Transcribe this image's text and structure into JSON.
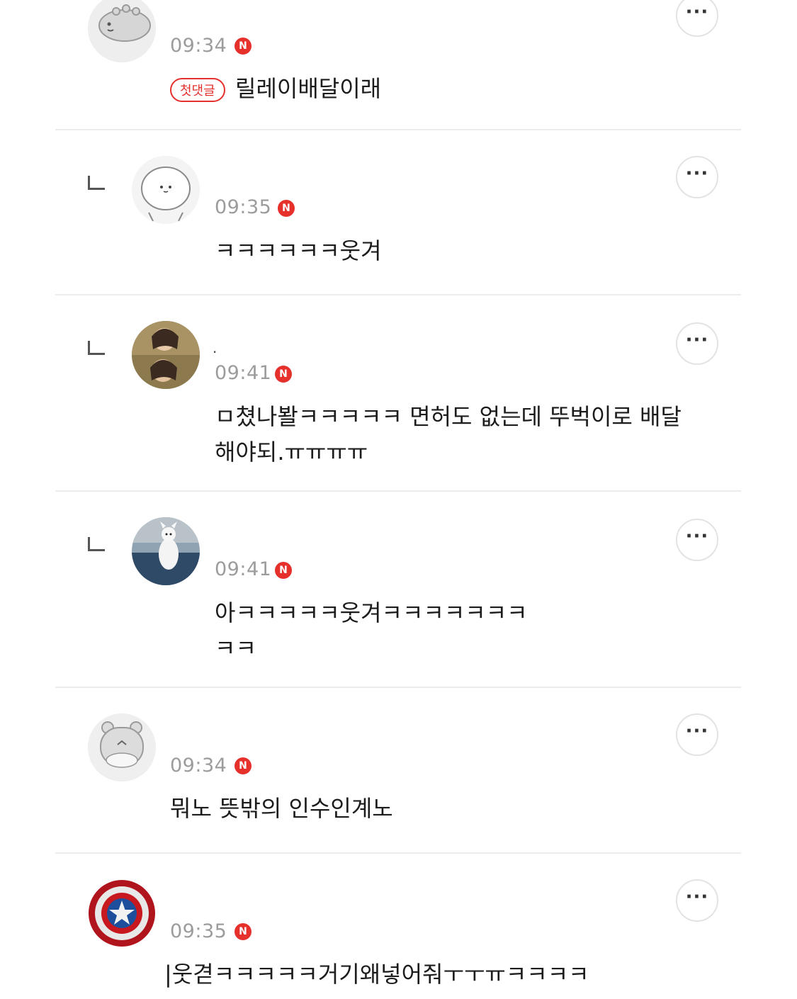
{
  "comments": [
    {
      "time": "09:34",
      "new_badge": "N",
      "first_badge": "첫댓글",
      "text": "릴레이배달이래",
      "more": "···",
      "avatar_icon": "dinosaur-avatar-icon"
    },
    {
      "time": "09:35",
      "new_badge": "N",
      "text": "ㅋㅋㅋㅋㅋㅋ웃겨",
      "more": "···",
      "reply_icon": "reply-arrow-icon",
      "avatar_icon": "round-face-avatar-icon"
    },
    {
      "nickname": ".",
      "time": "09:41",
      "new_badge": "N",
      "text": "ㅁ쳤나봘ㅋㅋㅋㅋㅋ 면허도 없는데 뚜벅이로 배달\n해야되.ㅠㅠㅠㅠ",
      "more": "···",
      "reply_icon": "reply-arrow-icon",
      "avatar_icon": "photo-avatar-icon"
    },
    {
      "time": "09:41",
      "new_badge": "N",
      "text": "아ㅋㅋㅋㅋㅋ웃겨ㅋㅋㅋㅋㅋㅋㅋ\nㅋㅋ",
      "more": "···",
      "reply_icon": "reply-arrow-icon",
      "avatar_icon": "dog-photo-avatar-icon"
    },
    {
      "time": "09:34",
      "new_badge": "N",
      "text": "뭐노 뜻밖의 인수인계노",
      "more": "···",
      "avatar_icon": "hamster-avatar-icon"
    },
    {
      "time": "09:35",
      "new_badge": "N",
      "text": "|웃겯ㅋㅋㅋㅋㅋ거기왜넣어줘ㅜㅜㅠㅋㅋㅋㅋ",
      "more": "···",
      "avatar_icon": "shield-avatar-icon"
    }
  ],
  "colors": {
    "accent": "#e5302c",
    "time": "#9c9c9c",
    "divider": "#ececec"
  }
}
